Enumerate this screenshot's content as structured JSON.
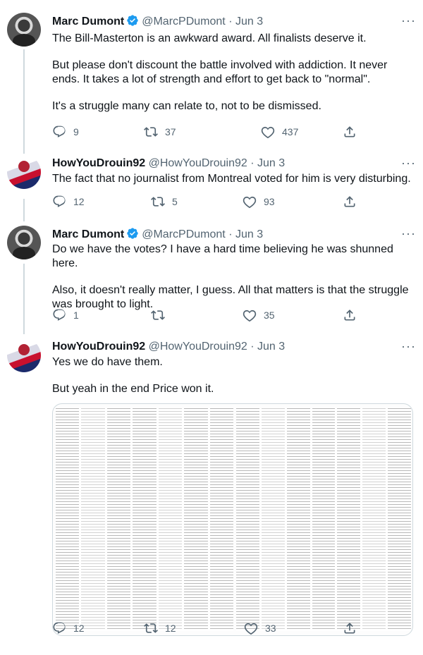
{
  "tweets": [
    {
      "name": "Marc Dumont",
      "verified": true,
      "handle": "@MarcPDumont",
      "separator": "·",
      "date": "Jun 3",
      "paragraphs": [
        "The Bill-Masterton is an awkward award. All finalists deserve it.",
        "But please don't discount the battle involved with addiction. It never ends. It takes a lot of strength and effort to get back to \"normal\".",
        "It's a struggle many can relate to, not to be dismissed."
      ],
      "replies": "9",
      "retweets": "37",
      "likes": "437"
    },
    {
      "name": "HowYouDrouin92",
      "verified": false,
      "handle": "@HowYouDrouin92",
      "separator": "·",
      "date": "Jun 3",
      "paragraphs": [
        "The fact that no journalist from Montreal voted for him is very disturbing."
      ],
      "replies": "12",
      "retweets": "5",
      "likes": "93"
    },
    {
      "name": "Marc Dumont",
      "verified": true,
      "handle": "@MarcPDumont",
      "separator": "·",
      "date": "Jun 3",
      "paragraphs": [
        "Do we have the votes? I have a hard time believing he was shunned here.",
        "Also, it doesn't really matter, I guess. All that matters is that the struggle was brought to light."
      ],
      "replies": "1",
      "retweets": "",
      "likes": "35"
    },
    {
      "name": "HowYouDrouin92",
      "verified": false,
      "handle": "@HowYouDrouin92",
      "separator": "·",
      "date": "Jun 3",
      "paragraphs": [
        "Yes we do have them.",
        "But yeah in the end Price won it."
      ],
      "replies": "12",
      "retweets": "12",
      "likes": "33"
    }
  ],
  "more_glyph": "···",
  "colors": {
    "text": "#0f1419",
    "secondary": "#536471",
    "verified": "#1d9bf0",
    "border": "#cfd9de"
  },
  "icons": [
    "reply-icon",
    "retweet-icon",
    "like-icon",
    "share-icon",
    "verified-badge-icon",
    "more-icon"
  ]
}
